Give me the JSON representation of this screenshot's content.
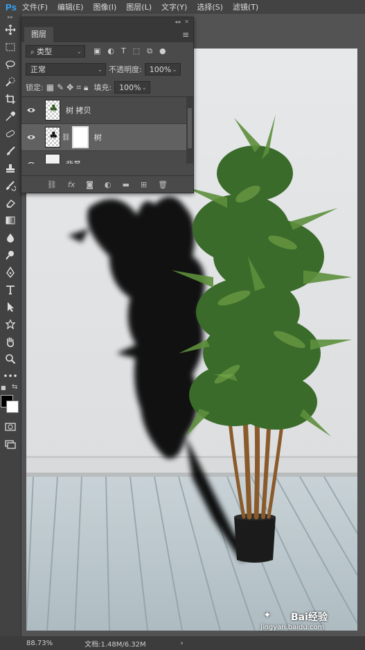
{
  "app": {
    "logo": "Ps"
  },
  "menu": [
    "文件(F)",
    "编辑(E)",
    "图像(I)",
    "图层(L)",
    "文字(Y)",
    "选择(S)",
    "滤镜(T)"
  ],
  "layers_panel": {
    "tab_label": "图层",
    "filter_kind": "类型",
    "blend_mode": "正常",
    "opacity_label": "不透明度:",
    "opacity_value": "100%",
    "lock_label": "锁定:",
    "fill_label": "填充:",
    "fill_value": "100%",
    "layers": [
      {
        "name": "树 拷贝"
      },
      {
        "name": "树"
      },
      {
        "name": "背景"
      }
    ],
    "footer_fx": "fx"
  },
  "status": {
    "zoom": "88.73%",
    "doc": "文档:1.48M/6.32M",
    "arrow": "›"
  },
  "watermark": {
    "brand": "Bai经验",
    "url": "jingyan.baidu.com"
  },
  "colors": {
    "foreground": "#000000",
    "background": "#ffffff"
  }
}
